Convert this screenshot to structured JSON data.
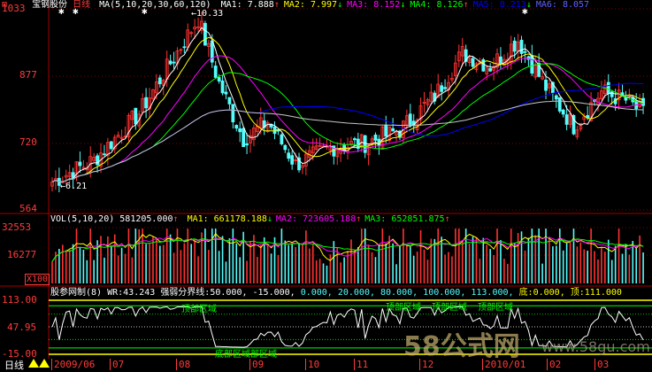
{
  "colors": {
    "axis_red": "#ff3b3b",
    "up_red": "#ff3232",
    "down_cyan": "#54fcfc",
    "ma5": "#ffffff",
    "ma10": "#ffff00",
    "ma20": "#ff00ff",
    "ma30": "#00ff00",
    "ma60": "#0000ff",
    "ma120": "#c8c8c8",
    "wr_line": "#ffffff",
    "strong_line": "#00ff00",
    "weak_line": "#ffff00"
  },
  "price_panel": {
    "stock_name": "宝钢股份",
    "period_label": "日线",
    "ma_label": "MA(5,10,20,30,60,120)",
    "ma_values": [
      {
        "name": "MA1:",
        "value": "7.888",
        "dir": "↑"
      },
      {
        "name": "MA2:",
        "value": "7.997",
        "dir": "↓"
      },
      {
        "name": "MA3:",
        "value": "8.152",
        "dir": "↓"
      },
      {
        "name": "MA4:",
        "value": "8.126",
        "dir": "↑"
      },
      {
        "name": "MA5:",
        "value": "8.213",
        "dir": "↓"
      },
      {
        "name": "MA6:",
        "value": "8.057",
        "dir": ""
      }
    ],
    "y_ticks": [
      "1033",
      "877",
      "720",
      "564"
    ],
    "high_marker": "10.33",
    "low_marker": "6.21"
  },
  "volume_panel": {
    "title": "VOL(5,10,20)",
    "vol_value": "581205.000",
    "ma_values": [
      {
        "name": "MA1:",
        "value": "661178.188",
        "dir": "↓"
      },
      {
        "name": "MA2:",
        "value": "723605.188",
        "dir": "↑"
      },
      {
        "name": "MA3:",
        "value": "652851.875",
        "dir": "↑"
      }
    ],
    "y_ticks": [
      "32553",
      "16277"
    ],
    "unit": "X100"
  },
  "wr_panel": {
    "title": "股参网制(8)",
    "wr_label": "WR:",
    "wr_value": "43.243",
    "boundary_label": "强弱分界线:",
    "boundary_values": "50.000, -15.000,",
    "extra_values": "0.000, 20.000, 80.000, 100.000, 113.000,",
    "bottom_label": "底:",
    "bottom_value": "0.000,",
    "top_label": "顶:",
    "top_value": "111.000",
    "y_ticks": [
      "113.00",
      "47.95",
      "-15.00"
    ],
    "top_zone_labels": [
      "顶部区域",
      "顶部区域",
      "顶部区域",
      "顶部区域"
    ],
    "bottom_zone_label": "底部区域部区域"
  },
  "bottom_bar": {
    "period_tab": "日线",
    "dates": [
      "2009/06",
      "07",
      "08",
      "09",
      "10",
      "11",
      "12",
      "2010/01",
      "02",
      "03"
    ]
  },
  "watermark": {
    "logo_text": "58公式网",
    "url": "www.58gu.com"
  }
}
